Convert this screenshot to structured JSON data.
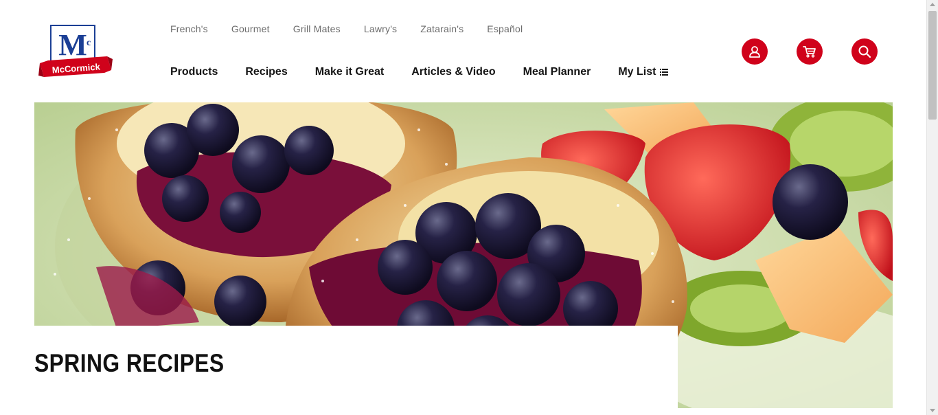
{
  "brand": {
    "logo_text": "McCormick",
    "accent_color": "#d0021b",
    "logo_blue": "#1b3f95"
  },
  "brand_nav": [
    {
      "label": "French's"
    },
    {
      "label": "Gourmet"
    },
    {
      "label": "Grill Mates"
    },
    {
      "label": "Lawry's"
    },
    {
      "label": "Zatarain's"
    },
    {
      "label": "Español"
    }
  ],
  "main_nav": [
    {
      "label": "Products"
    },
    {
      "label": "Recipes"
    },
    {
      "label": "Make it Great"
    },
    {
      "label": "Articles & Video"
    },
    {
      "label": "Meal Planner"
    },
    {
      "label": "My List",
      "icon": "list-icon"
    }
  ],
  "header_icons": [
    {
      "icon": "user-icon"
    },
    {
      "icon": "cart-icon"
    },
    {
      "icon": "search-icon"
    }
  ],
  "hero": {
    "image": "popovers-with-blueberries-and-fruit",
    "title": "SPRING RECIPES"
  }
}
